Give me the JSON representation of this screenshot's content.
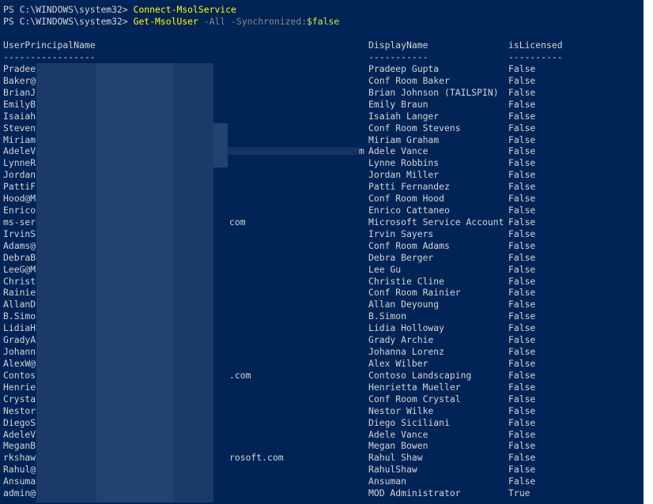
{
  "prompt_lines": [
    {
      "prompt": "PS C:\\WINDOWS\\system32> ",
      "command": "Connect-MsolService",
      "params": "",
      "value": ""
    },
    {
      "prompt": "PS C:\\WINDOWS\\system32> ",
      "command": "Get-MsolUser",
      "params": " -All -Synchronized:",
      "value": "$false"
    }
  ],
  "table": {
    "headers": [
      "UserPrincipalName",
      "DisplayName",
      "isLicensed"
    ],
    "underlines": [
      "-----------------",
      "-----------",
      "----------"
    ],
    "rows": [
      {
        "upn": "Pradee",
        "display": "Pradeep Gupta",
        "licensed": "False"
      },
      {
        "upn": "Baker@",
        "display": "Conf Room Baker",
        "licensed": "False"
      },
      {
        "upn": "BrianJ",
        "display": "Brian Johnson (TAILSPIN)",
        "licensed": "False"
      },
      {
        "upn": "EmilyB",
        "display": "Emily Braun",
        "licensed": "False"
      },
      {
        "upn": "Isaiah",
        "display": "Isaiah Langer",
        "licensed": "False"
      },
      {
        "upn": "Steven",
        "display": "Conf Room Stevens",
        "licensed": "False"
      },
      {
        "upn": "Miriam",
        "display": "Miriam Graham",
        "licensed": "False"
      },
      {
        "upn": "AdeleV",
        "display": "Adele Vance",
        "licensed": "False"
      },
      {
        "upn": "LynneR",
        "display": "Lynne Robbins",
        "licensed": "False"
      },
      {
        "upn": "Jordan",
        "display": "Jordan Miller",
        "licensed": "False"
      },
      {
        "upn": "PattiF",
        "display": "Patti Fernandez",
        "licensed": "False"
      },
      {
        "upn": "Hood@M",
        "display": "Conf Room Hood",
        "licensed": "False"
      },
      {
        "upn": "Enrico",
        "display": "Enrico Cattaneo",
        "licensed": "False"
      },
      {
        "upn": "ms-ser",
        "display": "Microsoft Service Account",
        "licensed": "False"
      },
      {
        "upn": "IrvinS",
        "display": "Irvin Sayers",
        "licensed": "False"
      },
      {
        "upn": "Adams@",
        "display": "Conf Room Adams",
        "licensed": "False"
      },
      {
        "upn": "DebraB",
        "display": "Debra Berger",
        "licensed": "False"
      },
      {
        "upn": "LeeG@M",
        "display": "Lee Gu",
        "licensed": "False"
      },
      {
        "upn": "Christ",
        "display": "Christie Cline",
        "licensed": "False"
      },
      {
        "upn": "Rainie",
        "display": "Conf Room Rainier",
        "licensed": "False"
      },
      {
        "upn": "AllanD",
        "display": "Allan Deyoung",
        "licensed": "False"
      },
      {
        "upn": "B.Simo",
        "display": "B.Simon",
        "licensed": "False"
      },
      {
        "upn": "LidiaH",
        "display": "Lidia Holloway",
        "licensed": "False"
      },
      {
        "upn": "GradyA",
        "display": "Grady Archie",
        "licensed": "False"
      },
      {
        "upn": "Johann",
        "display": "Johanna Lorenz",
        "licensed": "False"
      },
      {
        "upn": "AlexW@",
        "display": "Alex Wilber",
        "licensed": "False"
      },
      {
        "upn": "Contos",
        "display": "Contoso Landscaping",
        "licensed": "False"
      },
      {
        "upn": "Henrie",
        "display": "Henrietta Mueller",
        "licensed": "False"
      },
      {
        "upn": "Crysta",
        "display": "Conf Room Crystal",
        "licensed": "False"
      },
      {
        "upn": "Nestor",
        "display": "Nestor Wilke",
        "licensed": "False"
      },
      {
        "upn": "DiegoS",
        "display": "Diego Siciliani",
        "licensed": "False"
      },
      {
        "upn": "AdeleV",
        "display": "Adele Vance",
        "licensed": "False"
      },
      {
        "upn": "MeganB",
        "display": "Megan Bowen",
        "licensed": "False"
      },
      {
        "upn": "rkshaw",
        "display": "Rahul Shaw",
        "licensed": "False"
      },
      {
        "upn": "Rahul@",
        "display": "RahulShaw",
        "licensed": "False"
      },
      {
        "upn": "Ansuma",
        "display": "Ansuman",
        "licensed": "False"
      },
      {
        "upn": "admin@",
        "display": "MOD Administrator",
        "licensed": "True"
      }
    ],
    "visible_fragments": [
      {
        "row": 7,
        "text": "m"
      },
      {
        "row": 13,
        "text": "com"
      },
      {
        "row": 26,
        "text": ".com"
      },
      {
        "row": 33,
        "text": "rosoft.com"
      }
    ]
  },
  "colors": {
    "background": "#012456",
    "text": "#d4d4d4",
    "command": "#ffff00",
    "parameter": "#8a8a8a",
    "value": "#cde84a"
  }
}
